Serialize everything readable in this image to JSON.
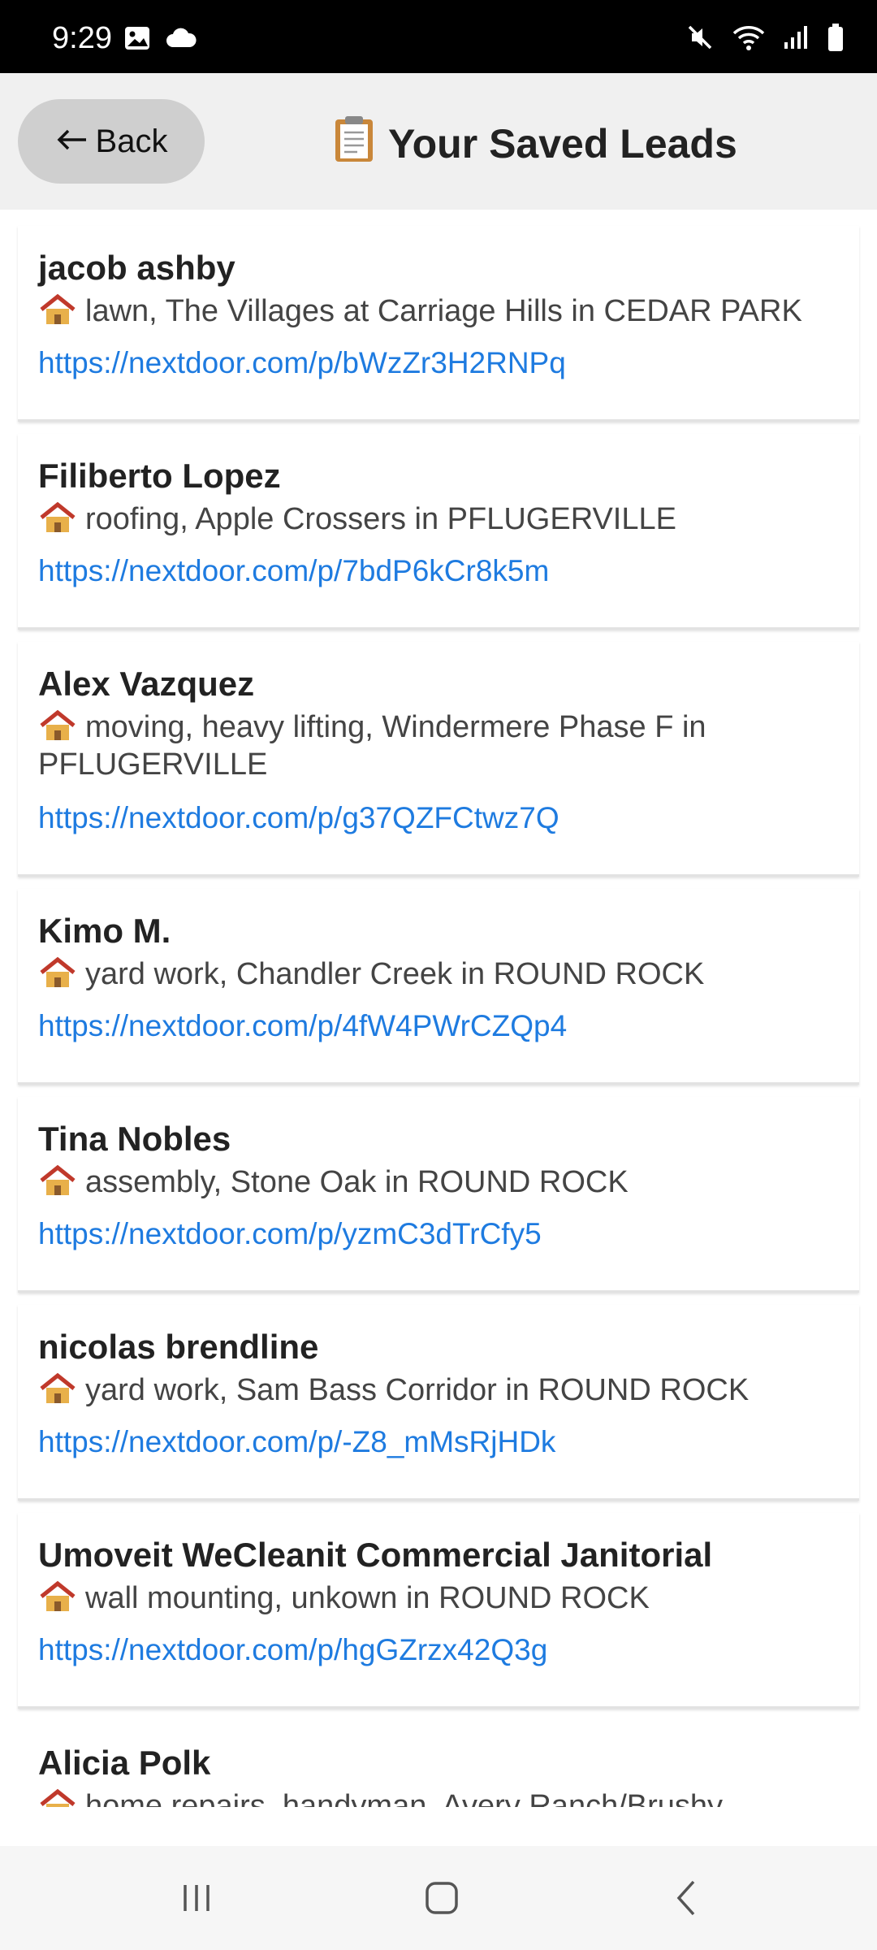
{
  "status_bar": {
    "time": "9:29"
  },
  "header": {
    "back_label": "Back",
    "title_text": "Your Saved Leads",
    "title_icon": "clipboard-icon"
  },
  "leads": [
    {
      "name": "jacob ashby",
      "desc": "lawn, The Villages at Carriage Hills in CEDAR PARK",
      "url": "https://nextdoor.com/p/bWzZr3H2RNPq"
    },
    {
      "name": "Filiberto Lopez",
      "desc": "roofing, Apple Crossers in PFLUGERVILLE",
      "url": "https://nextdoor.com/p/7bdP6kCr8k5m"
    },
    {
      "name": "Alex Vazquez",
      "desc": "moving, heavy lifting, Windermere Phase F in PFLUGERVILLE",
      "url": "https://nextdoor.com/p/g37QZFCtwz7Q"
    },
    {
      "name": "Kimo M.",
      "desc": "yard work, Chandler Creek in ROUND ROCK",
      "url": "https://nextdoor.com/p/4fW4PWrCZQp4"
    },
    {
      "name": "Tina Nobles",
      "desc": "assembly, Stone Oak in ROUND ROCK",
      "url": "https://nextdoor.com/p/yzmC3dTrCfy5"
    },
    {
      "name": "nicolas brendline",
      "desc": "yard work, Sam Bass Corridor in ROUND ROCK",
      "url": "https://nextdoor.com/p/-Z8_mMsRjHDk"
    },
    {
      "name": "Umoveit WeCleanit Commercial Janitorial",
      "desc": "wall mounting, unkown in ROUND ROCK",
      "url": "https://nextdoor.com/p/hgGZrzx42Q3g"
    },
    {
      "name": "Alicia Polk",
      "desc": "home repairs, handyman, Avery Ranch/Brushy",
      "url": ""
    }
  ],
  "colors": {
    "link": "#1e7be0",
    "header_bg": "#f0f0f0",
    "back_button_bg": "#cfcfcf"
  }
}
